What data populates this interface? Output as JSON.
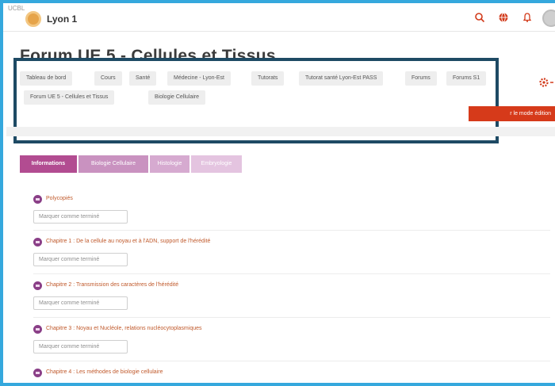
{
  "navbar": {
    "logo_tag": "UCBL",
    "site_name": "Lyon 1",
    "icons": [
      "search-icon",
      "globe-icon",
      "bell-icon",
      "avatar"
    ]
  },
  "header": {
    "title": "Forum UE 5 - Cellules et Tissus",
    "breadcrumbs": [
      "Tableau de bord",
      "Cours",
      "Santé",
      "Médecine - Lyon-Est",
      "Tutorats",
      "Tutorat santé Lyon-Est PASS",
      "Forums",
      "Forums S1",
      "Forum UE 5 - Cellules et Tissus",
      "Biologie Cellulaire"
    ],
    "edit_button": "r le mode édition"
  },
  "tabs": [
    "Informations",
    "Biologie Cellulaire",
    "Histologie",
    "Embryologie"
  ],
  "activities": [
    {
      "title": "Polycopiés",
      "button": "Marquer comme terminé"
    },
    {
      "title": "Chapitre 1 : De la cellule au noyau et à l'ADN, support de l'hérédité",
      "button": "Marquer comme terminé"
    },
    {
      "title": "Chapitre 2 : Transmission des caractères de l'hérédité",
      "button": "Marquer comme terminé"
    },
    {
      "title": "Chapitre 3 : Noyau et Nucléole, relations nucléocytoplasmiques",
      "button": "Marquer comme terminé"
    },
    {
      "title": "Chapitre 4 : Les méthodes de biologie cellulaire",
      "button": ""
    }
  ],
  "colors": {
    "frame": "#35a8dd",
    "highlight": "#1e4a64",
    "accent": "#b24c91",
    "link": "#c05a2c",
    "edit_button": "#d63a1a"
  }
}
